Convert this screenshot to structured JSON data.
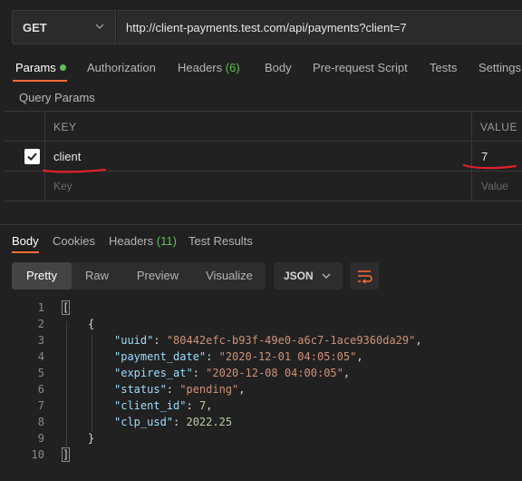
{
  "request": {
    "method": "GET",
    "url": "http://client-payments.test.com/api/payments?client=7"
  },
  "tabs": {
    "params": "Params",
    "authorization": "Authorization",
    "headers": "Headers",
    "headers_count": "(6)",
    "body": "Body",
    "pre_request": "Pre-request Script",
    "tests": "Tests",
    "settings": "Settings"
  },
  "query_params": {
    "title": "Query Params",
    "col_key": "KEY",
    "col_value": "VALUE",
    "rows": [
      {
        "checked": true,
        "key": "client",
        "value": "7"
      }
    ],
    "placeholder_key": "Key",
    "placeholder_value": "Value"
  },
  "response_tabs": {
    "body": "Body",
    "cookies": "Cookies",
    "headers": "Headers",
    "headers_count": "(11)",
    "test_results": "Test Results"
  },
  "view": {
    "pretty": "Pretty",
    "raw": "Raw",
    "preview": "Preview",
    "visualize": "Visualize",
    "format": "JSON"
  },
  "response_body": {
    "line_numbers": [
      "1",
      "2",
      "3",
      "4",
      "5",
      "6",
      "7",
      "8",
      "9",
      "10"
    ],
    "open_bracket": "[",
    "open_brace": "{",
    "uuid_key": "\"uuid\"",
    "uuid_val": "\"80442efc-b93f-49e0-a6c7-1ace9360da29\"",
    "payment_date_key": "\"payment_date\"",
    "payment_date_val": "\"2020-12-01 04:05:05\"",
    "expires_at_key": "\"expires_at\"",
    "expires_at_val": "\"2020-12-08 04:00:05\"",
    "status_key": "\"status\"",
    "status_val": "\"pending\"",
    "client_id_key": "\"client_id\"",
    "client_id_val": "7",
    "clp_usd_key": "\"clp_usd\"",
    "clp_usd_val": "2022.25",
    "close_brace": "}",
    "close_bracket": "]"
  },
  "colors": {
    "accent": "#ff6c37",
    "success": "#5fbf56",
    "annotation": "#e0202a"
  }
}
